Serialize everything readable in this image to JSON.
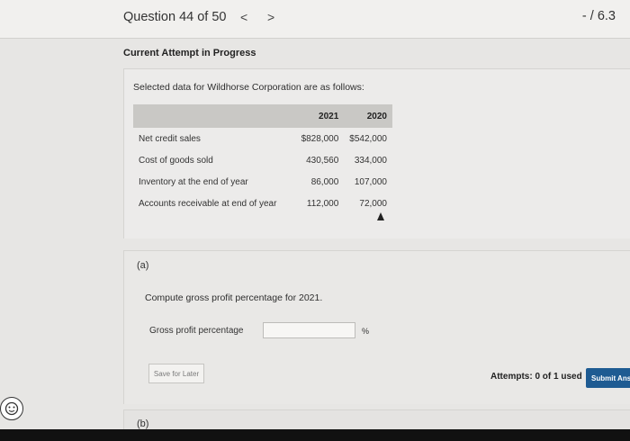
{
  "header": {
    "question_title": "Question 44 of 50",
    "prev_icon": "<",
    "next_icon": ">",
    "score": "- / 6.3"
  },
  "attempt_status": "Current Attempt in Progress",
  "problem": {
    "intro": "Selected data for Wildhorse Corporation are as follows:",
    "table": {
      "headers": [
        "",
        "2021",
        "2020"
      ],
      "rows": [
        {
          "label": "Net credit sales",
          "v2021": "$828,000",
          "v2020": "$542,000"
        },
        {
          "label": "Cost of goods sold",
          "v2021": "430,560",
          "v2020": "334,000"
        },
        {
          "label": "Inventory at the end of year",
          "v2021": "86,000",
          "v2020": "107,000"
        },
        {
          "label": "Accounts receivable at end of year",
          "v2021": "112,000",
          "v2020": "72,000"
        }
      ]
    }
  },
  "part_a": {
    "label": "(a)",
    "question": "Compute gross profit percentage for 2021.",
    "input_label": "Gross profit percentage",
    "input_value": "",
    "unit": "%",
    "save_button": "Save for Later",
    "attempts": "Attempts: 0 of 1 used",
    "submit_button": "Submit Answer"
  },
  "part_b": {
    "label": "(b)"
  },
  "icons": {
    "help": "help-circle-icon",
    "cursor": "mouse-pointer-icon"
  }
}
